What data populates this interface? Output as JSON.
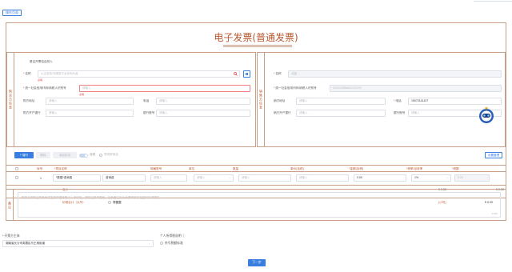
{
  "top_button": "操作页面",
  "invoice_title": "电子发票(普通发票)",
  "buyer": {
    "section_label": "购买方信息",
    "natural_person": "是否开票给自然人",
    "name_label": "名称",
    "name_placeholder": "以企查查/天眼查平台查询为准",
    "name_error": "必填",
    "tax_id_label": "统一社会信用代码/纳税人识别号",
    "tax_id_placeholder": "请输入",
    "tax_id_error": "必填",
    "address_label": "购方地址",
    "address_placeholder": "请输入",
    "phone_label": "电话",
    "phone_placeholder": "请输入",
    "bank_label": "购方开户银行",
    "bank_placeholder": "请输入",
    "account_label": "银行账号",
    "account_placeholder": "请输入"
  },
  "seller": {
    "section_label": "销售方信息",
    "name_label": "名称",
    "name_value": "北极",
    "tax_id_label": "统一社会信用代码/纳税人识别号",
    "tax_id_value": "91110108MA01XXXXX",
    "address_label": "销方地址",
    "address_placeholder": "请输入",
    "phone_label": "电话",
    "phone_value": "15073141137",
    "bank_label": "销方开户银行",
    "bank_placeholder": "请输入",
    "account_label": "银行账号",
    "account_placeholder": "请输入"
  },
  "toolbar": {
    "add": "+ 增行",
    "delete": "删除",
    "discount": "添加折扣",
    "toggle_label": "含税",
    "radio_label": "零税率商品",
    "right_button": "设置管理"
  },
  "table": {
    "headers": [
      "序号",
      "*项目名称",
      "规格型号",
      "单位",
      "数量",
      "单价(含税)",
      "*金额(含税)",
      "*税率/征收率",
      "*税额"
    ],
    "row": {
      "index": "1",
      "item": "*数据*咨询费",
      "item_suffix": "咨询费",
      "spec": "请输入",
      "unit": "请输入",
      "qty": "请输入",
      "price": "请输入",
      "amount": "0.00",
      "rate": "1%",
      "tax": "0.00"
    }
  },
  "totals": {
    "label": "合计",
    "amount": "¥ 0.00",
    "tax": "¥ 0.00"
  },
  "total_tax_inc": {
    "label": "价税合计（大写）",
    "upper_value": "零圆整",
    "lower_label": "(小写)",
    "lower_value": "¥ 0.00"
  },
  "remark": {
    "section_label": "备注",
    "placeholder": "购货方采购合同号码或发货单据号等个人单填写，请保留原单据号，若有备注则为开票审核存在疑问时请提供。",
    "count": "0/200"
  },
  "footer": {
    "issuer_label": "* 开票方主体",
    "issuer_value": "湖南省长沙市芙蓉区马王堆街道",
    "personal_label": "个人所得税说明",
    "personal_value": "符号税额标准",
    "next_button": "下一步"
  },
  "colors": {
    "accent": "#3a7ee0",
    "border": "#c8a08a",
    "title": "#b8572e"
  }
}
